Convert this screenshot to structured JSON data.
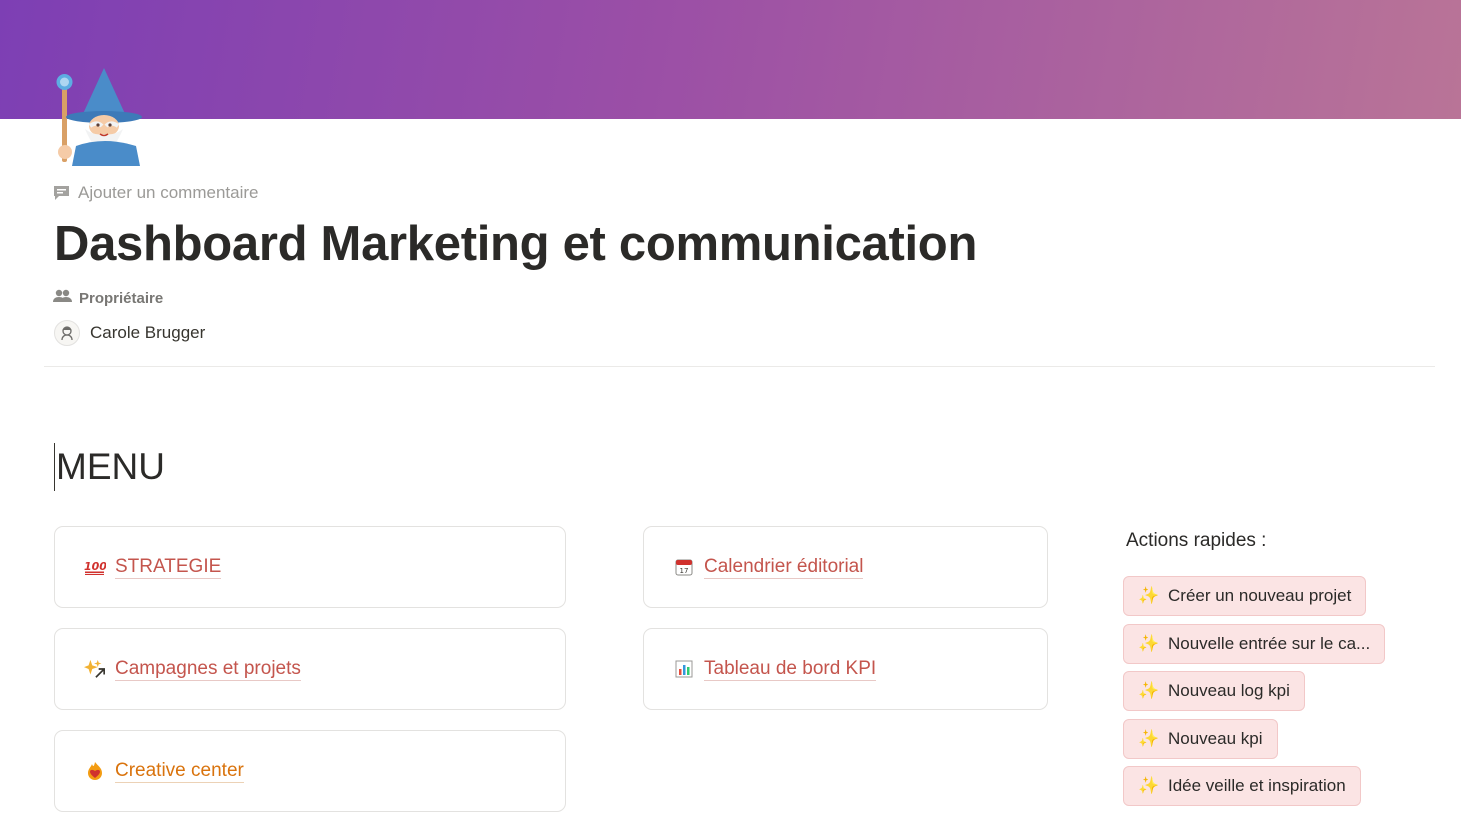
{
  "header": {
    "add_comment": "Ajouter un commentaire",
    "title": "Dashboard Marketing et communication",
    "page_icon": "wizard-emoji"
  },
  "properties": {
    "owner_label": "Propriétaire",
    "owner_name": "Carole Brugger"
  },
  "menu": {
    "heading": "MENU",
    "links": [
      {
        "icon": "hundred-points-icon",
        "label": "STRATEGIE"
      },
      {
        "icon": "calendar-icon",
        "label": "Calendrier éditorial"
      },
      {
        "icon": "sparkles-arrow-icon",
        "label": "Campagnes et projets"
      },
      {
        "icon": "bar-chart-icon",
        "label": "Tableau de bord KPI"
      },
      {
        "icon": "heart-on-fire-icon",
        "label": "Creative center"
      }
    ]
  },
  "quick_actions": {
    "title": "Actions rapides :",
    "buttons": [
      {
        "icon": "sparkles-icon",
        "label": "Créer un nouveau projet"
      },
      {
        "icon": "sparkles-icon",
        "label": "Nouvelle entrée sur le ca..."
      },
      {
        "icon": "sparkles-icon",
        "label": "Nouveau log kpi"
      },
      {
        "icon": "sparkles-icon",
        "label": "Nouveau kpi"
      },
      {
        "icon": "sparkles-icon",
        "label": "Idée veille et inspiration"
      }
    ]
  },
  "colors": {
    "link_red": "#c4554d",
    "link_orange": "#d9730d",
    "button_bg": "#fbe4e4",
    "cover_start": "#7d3fb4",
    "cover_end": "#b97497"
  }
}
